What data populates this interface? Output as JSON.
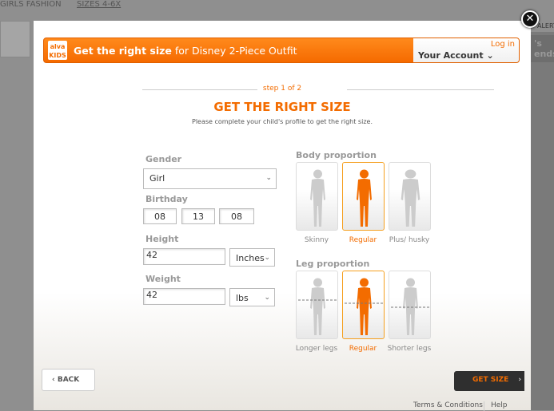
{
  "background": {
    "nav": [
      "GIRLS FASHION",
      "SIZES 4-6X"
    ],
    "alert": "ALERT",
    "promo": "'s\nends"
  },
  "header": {
    "logo": "alva KIDS",
    "title_bold": "Get the right size",
    "title_rest": " for Disney 2-Piece Outfit",
    "login": "Log in",
    "account": "Your Account"
  },
  "step": "step 1 of 2",
  "title": "GET THE RIGHT SIZE",
  "subtitle": "Please complete your child's profile to get the right size.",
  "form": {
    "gender_label": "Gender",
    "gender": "Girl",
    "birthday_label": "Birthday",
    "birthday": [
      "08",
      "13",
      "08"
    ],
    "height_label": "Height",
    "height": "42",
    "height_unit": "Inches",
    "weight_label": "Weight",
    "weight": "42",
    "weight_unit": "lbs"
  },
  "body": {
    "label": "Body proportion",
    "options": [
      "Skinny",
      "Regular",
      "Plus/ husky"
    ],
    "selected": 1
  },
  "legs": {
    "label": "Leg proportion",
    "options": [
      "Longer legs",
      "Regular",
      "Shorter legs"
    ],
    "selected": 1
  },
  "buttons": {
    "back": "BACK",
    "get_size": "GET SIZE"
  },
  "footer": {
    "terms": "Terms & Conditions",
    "help": "Help"
  },
  "colors": {
    "accent": "#f36c00",
    "inactive_figure": "#cccccc"
  }
}
